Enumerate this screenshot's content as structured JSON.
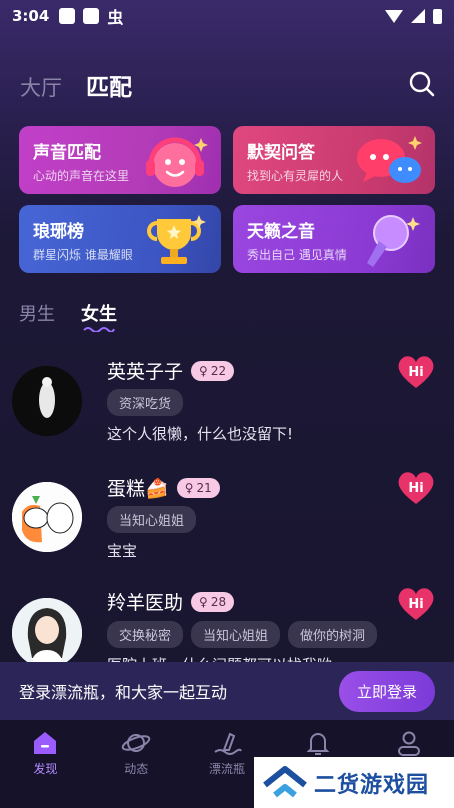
{
  "status_bar": {
    "time": "3:04",
    "notif_glyph": "虫"
  },
  "top_tabs": [
    {
      "label": "大厅",
      "active": false
    },
    {
      "label": "匹配",
      "active": true
    }
  ],
  "cards": [
    {
      "id": "voice",
      "title": "声音匹配",
      "subtitle": "心动的声音在这里",
      "art_icon": "headphone-face-icon"
    },
    {
      "id": "tacit",
      "title": "默契问答",
      "subtitle": "找到心有灵犀的人",
      "art_icon": "chat-bubbles-icon"
    },
    {
      "id": "rank",
      "title": "琅琊榜",
      "subtitle": "群星闪烁 谁最耀眼",
      "art_icon": "trophy-icon"
    },
    {
      "id": "sound",
      "title": "天籁之音",
      "subtitle": "秀出自己 遇见真情",
      "art_icon": "microphone-icon"
    }
  ],
  "gender_tabs": [
    {
      "label": "男生",
      "active": false
    },
    {
      "label": "女生",
      "active": true
    }
  ],
  "users": [
    {
      "name": "英英子子",
      "name_emoji": "",
      "age": "22",
      "tags": [
        "资深吃货"
      ],
      "desc": "这个人很懒，什么也没留下!"
    },
    {
      "name": "蛋糕",
      "name_emoji": "🍰",
      "age": "21",
      "tags": [
        "当知心姐姐"
      ],
      "desc": "宝宝"
    },
    {
      "name": "羚羊医助",
      "name_emoji": "",
      "age": "28",
      "tags": [
        "交换秘密",
        "当知心姐姐",
        "做你的树洞"
      ],
      "desc": "医院上班，什么问题都可以找我哟"
    }
  ],
  "hi_label": "Hi",
  "login_banner": {
    "text": "登录漂流瓶，和大家一起互动",
    "button": "立即登录"
  },
  "bottom_nav": [
    {
      "label": "发现",
      "icon": "home-icon",
      "active": true
    },
    {
      "label": "动态",
      "icon": "planet-icon",
      "active": false
    },
    {
      "label": "漂流瓶",
      "icon": "wave-icon",
      "active": false
    },
    {
      "label": "",
      "icon": "bell-icon",
      "active": false
    },
    {
      "label": "",
      "icon": "profile-icon",
      "active": false
    }
  ],
  "watermark": {
    "text": "二货游戏园"
  },
  "colors": {
    "accent": "#9a4fe8",
    "bg": "#18152e",
    "badge": "#f7c9e4",
    "hi": "#e8326a"
  }
}
